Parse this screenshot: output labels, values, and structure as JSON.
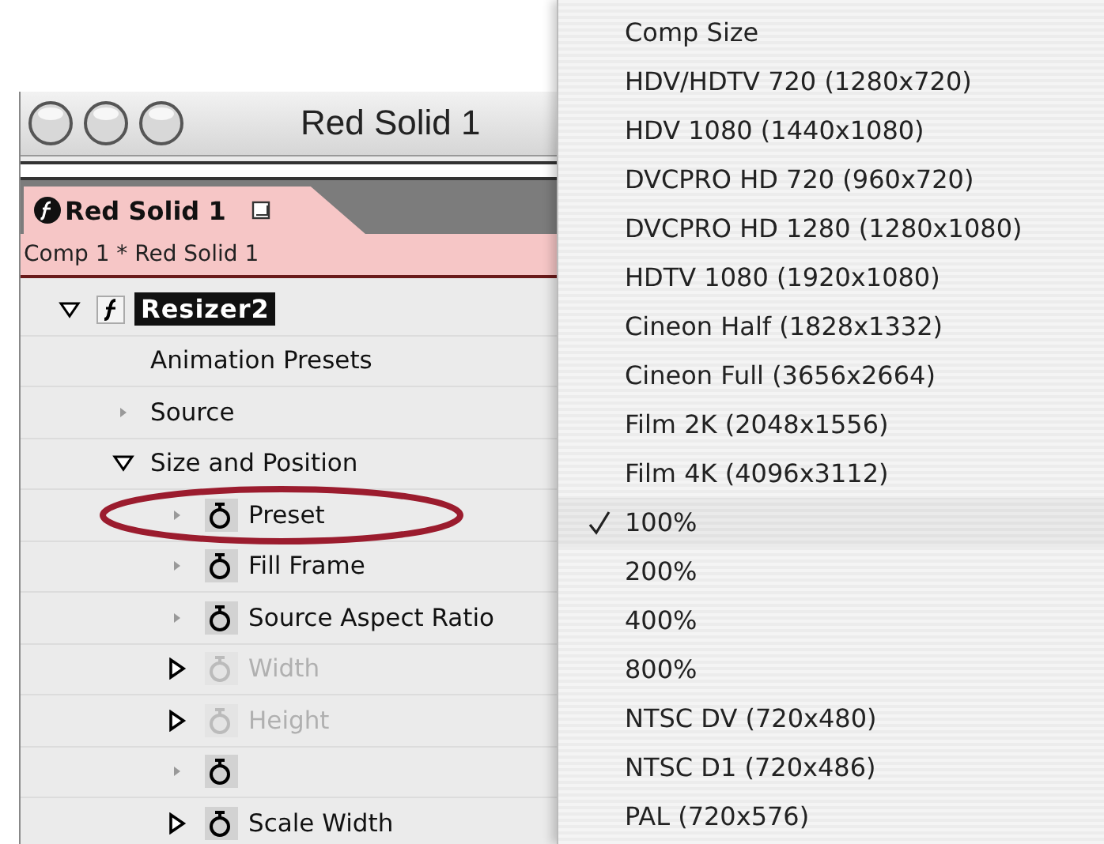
{
  "window": {
    "title": "Red Solid 1"
  },
  "tab": {
    "label": "Red Solid 1",
    "selected": true
  },
  "breadcrumb": "Comp 1 * Red Solid 1",
  "effect": {
    "name": "Resizer2",
    "kind": "effect",
    "expanded": true,
    "children": [
      {
        "name": "Animation Presets",
        "kind": "label"
      },
      {
        "name": "Source",
        "kind": "item"
      },
      {
        "name": "Size and Position",
        "kind": "group",
        "expanded": true,
        "children": [
          {
            "name": "Preset",
            "kind": "item",
            "animatable": true,
            "disabled": false,
            "annotated": true
          },
          {
            "name": "Fill Frame",
            "kind": "item",
            "animatable": true,
            "disabled": false
          },
          {
            "name": "Source Aspect Ratio",
            "kind": "item",
            "animatable": true,
            "disabled": false
          },
          {
            "name": "Width",
            "kind": "group",
            "expanded": false,
            "animatable": true,
            "disabled": true
          },
          {
            "name": "Height",
            "kind": "group",
            "expanded": false,
            "animatable": true,
            "disabled": true
          },
          {
            "kind": "item",
            "animatable": true,
            "disabled": false
          },
          {
            "name": "Scale Width",
            "kind": "group",
            "expanded": false,
            "animatable": true,
            "disabled": false
          }
        ]
      }
    ]
  },
  "menu": {
    "items": [
      {
        "label": "Comp Size",
        "selected": false
      },
      {
        "label": "HDV/HDTV 720 (1280x720)",
        "selected": false
      },
      {
        "label": "HDV 1080 (1440x1080)",
        "selected": false
      },
      {
        "label": "DVCPRO HD 720 (960x720)",
        "selected": false
      },
      {
        "label": "DVCPRO HD 1280 (1280x1080)",
        "selected": false
      },
      {
        "label": "HDTV 1080 (1920x1080)",
        "selected": false
      },
      {
        "label": "Cineon Half (1828x1332)",
        "selected": false
      },
      {
        "label": "Cineon Full (3656x2664)",
        "selected": false
      },
      {
        "label": "Film 2K (2048x1556)",
        "selected": false
      },
      {
        "label": "Film 4K (4096x3112)",
        "selected": false
      },
      {
        "label": "100%",
        "selected": true
      },
      {
        "label": "200%",
        "selected": false
      },
      {
        "label": "400%",
        "selected": false
      },
      {
        "label": "800%",
        "selected": false
      },
      {
        "label": "NTSC DV (720x480)",
        "selected": false
      },
      {
        "label": "NTSC D1 (720x486)",
        "selected": false
      },
      {
        "label": "PAL (720x576)",
        "selected": false
      }
    ]
  }
}
